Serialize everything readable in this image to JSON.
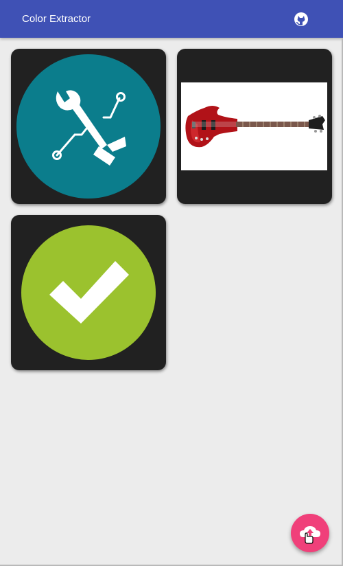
{
  "app_bar": {
    "title": "Color Extractor",
    "github_icon": "github-icon",
    "color": "#3f51b5"
  },
  "gallery": {
    "items": [
      {
        "image": "tools-icon",
        "background": "#0b7d8c"
      },
      {
        "image": "red-bass-guitar-photo",
        "background": "#ffffff"
      },
      {
        "image": "checkmark-icon",
        "background": "#9bc22e"
      }
    ]
  },
  "fab": {
    "icon": "cloud-upload-icon",
    "color": "#f0407a"
  }
}
